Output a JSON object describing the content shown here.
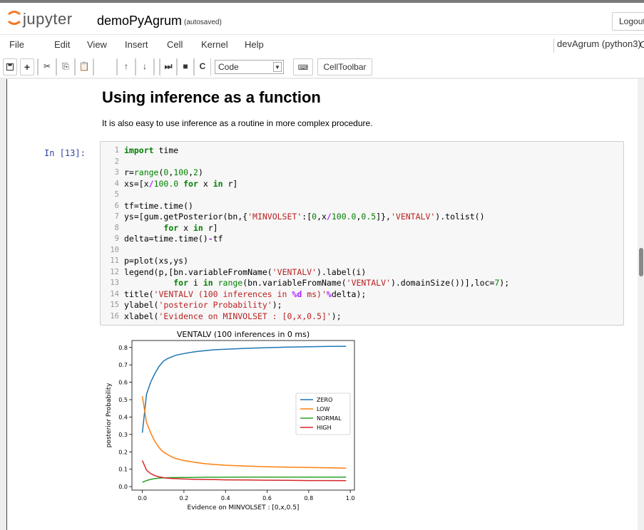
{
  "header": {
    "logo_text": "jupyter",
    "notebook_name": "demoPyAgrum",
    "autosave": "(autosaved)",
    "logout_label": "Logout"
  },
  "menu": {
    "items": [
      "File",
      "Edit",
      "View",
      "Insert",
      "Cell",
      "Kernel",
      "Help"
    ],
    "kernel_name": "devAgrum (python3)",
    "kernel_indicator": "O"
  },
  "toolbar": {
    "cell_type": "Code",
    "celltoolbar_label": "CellToolbar"
  },
  "markdown": {
    "heading": "Using inference as a function",
    "paragraph": "It is also easy to use inference as a routine in more complex procedure."
  },
  "code_cell": {
    "prompt": "In [13]:",
    "line_numbers": [
      "1",
      "2",
      "3",
      "4",
      "5",
      "6",
      "7",
      "8",
      "9",
      "10",
      "11",
      "12",
      "13",
      "14",
      "15",
      "16"
    ],
    "lines": [
      "import time",
      "",
      "r=range(0,100,2)",
      "xs=[x/100.0 for x in r]",
      "",
      "tf=time.time()",
      "ys=[gum.getPosterior(bn,{'MINVOLSET':[0,x/100.0,0.5]},'VENTALV').tolist()",
      "        for x in r]",
      "delta=time.time()-tf",
      "",
      "p=plot(xs,ys)",
      "legend(p,[bn.variableFromName('VENTALV').label(i)",
      "          for i in range(bn.variableFromName('VENTALV').domainSize())],loc=7);",
      "title('VENTALV (100 inferences in %d ms)'%delta);",
      "ylabel('posterior Probability');",
      "xlabel('Evidence on MINVOLSET : [0,x,0.5]');"
    ]
  },
  "chart_data": {
    "type": "line",
    "title": "VENTALV (100 inferences in 0 ms)",
    "xlabel": "Evidence on MINVOLSET : [0,x,0.5]",
    "ylabel": "posterior Probability",
    "xlim": [
      -0.05,
      1.02
    ],
    "ylim": [
      -0.02,
      0.84
    ],
    "xticks": [
      "0.0",
      "0.2",
      "0.4",
      "0.6",
      "0.8",
      "1.0"
    ],
    "yticks": [
      "0.0",
      "0.1",
      "0.2",
      "0.3",
      "0.4",
      "0.5",
      "0.6",
      "0.7",
      "0.8"
    ],
    "legend_position": "center-right",
    "grid": false,
    "x": [
      0.0,
      0.02,
      0.04,
      0.06,
      0.08,
      0.1,
      0.12,
      0.14,
      0.16,
      0.2,
      0.25,
      0.3,
      0.35,
      0.4,
      0.5,
      0.6,
      0.7,
      0.8,
      0.9,
      0.98
    ],
    "series": [
      {
        "name": "ZERO",
        "color": "#1f77b4",
        "values": [
          0.31,
          0.53,
          0.6,
          0.65,
          0.69,
          0.72,
          0.735,
          0.745,
          0.755,
          0.765,
          0.775,
          0.782,
          0.787,
          0.79,
          0.795,
          0.799,
          0.802,
          0.804,
          0.806,
          0.807
        ]
      },
      {
        "name": "LOW",
        "color": "#ff7f0e",
        "values": [
          0.52,
          0.37,
          0.31,
          0.26,
          0.225,
          0.2,
          0.185,
          0.172,
          0.162,
          0.15,
          0.14,
          0.132,
          0.127,
          0.123,
          0.118,
          0.114,
          0.112,
          0.11,
          0.108,
          0.106
        ]
      },
      {
        "name": "NORMAL",
        "color": "#2ca02c",
        "values": [
          0.025,
          0.035,
          0.042,
          0.046,
          0.049,
          0.05,
          0.051,
          0.052,
          0.052,
          0.053,
          0.053,
          0.054,
          0.054,
          0.054,
          0.055,
          0.055,
          0.055,
          0.055,
          0.055,
          0.055
        ]
      },
      {
        "name": "HIGH",
        "color": "#d62728",
        "values": [
          0.15,
          0.095,
          0.075,
          0.063,
          0.056,
          0.052,
          0.049,
          0.047,
          0.046,
          0.044,
          0.042,
          0.041,
          0.04,
          0.039,
          0.038,
          0.037,
          0.036,
          0.035,
          0.035,
          0.034
        ]
      }
    ]
  }
}
